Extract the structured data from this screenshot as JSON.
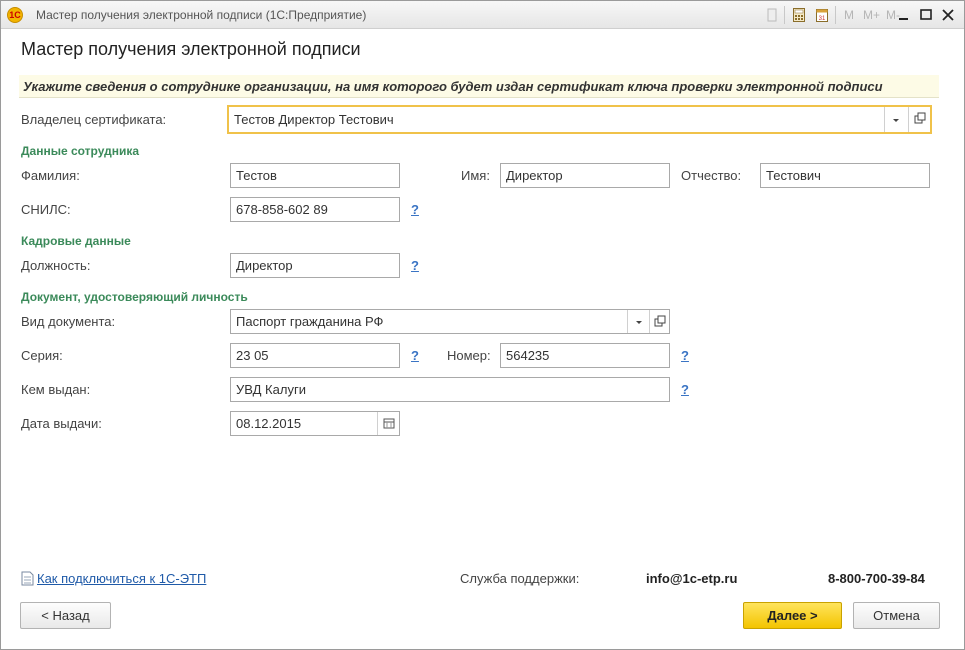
{
  "titlebar": {
    "title": "Мастер получения электронной подписи  (1С:Предприятие)",
    "m_labels": [
      "M",
      "M+",
      "M-"
    ]
  },
  "form": {
    "title": "Мастер получения электронной подписи",
    "banner": "Укажите сведения о сотруднике организации, на имя которого будет издан сертификат ключа проверки электронной подписи"
  },
  "owner": {
    "label": "Владелец сертификата:",
    "value": "Тестов Директор Тестович"
  },
  "employee": {
    "section": "Данные сотрудника",
    "lastname_label": "Фамилия:",
    "lastname": "Тестов",
    "firstname_label": "Имя:",
    "firstname": "Директор",
    "middlename_label": "Отчество:",
    "middlename": "Тестович",
    "snils_label": "СНИЛС:",
    "snils": "678-858-602 89"
  },
  "hr": {
    "section": "Кадровые данные",
    "position_label": "Должность:",
    "position": "Директор"
  },
  "document": {
    "section": "Документ, удостоверяющий личность",
    "type_label": "Вид документа:",
    "type": "Паспорт гражданина РФ",
    "series_label": "Серия:",
    "series": "23 05",
    "number_label": "Номер:",
    "number": "564235",
    "issuer_label": "Кем выдан:",
    "issuer": "УВД Калуги",
    "date_label": "Дата выдачи:",
    "date": "08.12.2015"
  },
  "help_mark": "?",
  "footer": {
    "link": "Как подключиться к 1С-ЭТП",
    "support_label": "Служба поддержки:",
    "support_email": "info@1c-etp.ru",
    "support_phone": "8-800-700-39-84"
  },
  "buttons": {
    "back": "< Назад",
    "next": "Далее >",
    "cancel": "Отмена"
  },
  "colors": {
    "accent_yellow": "#f3c400",
    "section_green": "#3b8a5a",
    "link_blue": "#1f5aa8"
  }
}
